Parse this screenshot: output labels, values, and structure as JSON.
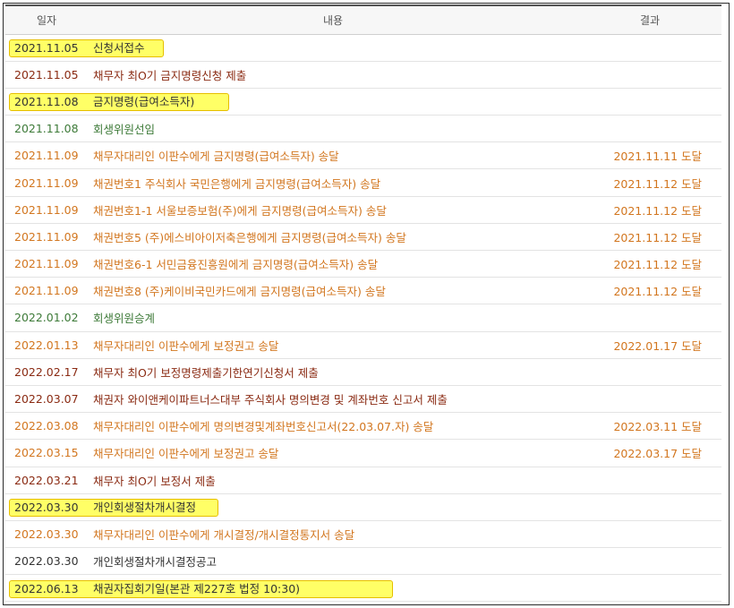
{
  "headers": {
    "date": "일자",
    "content": "내용",
    "result": "결과"
  },
  "rows": [
    {
      "date": "2021.11.05",
      "content": "신청서접수",
      "result": "",
      "color": "#333333",
      "highlight": true
    },
    {
      "date": "2021.11.05",
      "content": "채무자 최O기 금지명령신청 제출",
      "result": "",
      "color": "#8a2a12",
      "highlight": false
    },
    {
      "date": "2021.11.08",
      "content": "금지명령(급여소득자)",
      "result": "",
      "color": "#333333",
      "highlight": true
    },
    {
      "date": "2021.11.08",
      "content": "회생위원선임",
      "result": "",
      "color": "#3d7a38",
      "highlight": false
    },
    {
      "date": "2021.11.09",
      "content": "채무자대리인 이판수에게 금지명령(급여소득자) 송달",
      "result": "2021.11.11 도달",
      "color": "#d2761f",
      "highlight": false
    },
    {
      "date": "2021.11.09",
      "content": "채권번호1 주식회사 국민은행에게 금지명령(급여소득자) 송달",
      "result": "2021.11.12 도달",
      "color": "#d2761f",
      "highlight": false
    },
    {
      "date": "2021.11.09",
      "content": "채권번호1-1 서울보증보험(주)에게 금지명령(급여소득자) 송달",
      "result": "2021.11.12 도달",
      "color": "#d2761f",
      "highlight": false
    },
    {
      "date": "2021.11.09",
      "content": "채권번호5 (주)에스비아이저축은행에게 금지명령(급여소득자) 송달",
      "result": "2021.11.12 도달",
      "color": "#d2761f",
      "highlight": false
    },
    {
      "date": "2021.11.09",
      "content": "채권번호6-1 서민금융진흥원에게 금지명령(급여소득자) 송달",
      "result": "2021.11.12 도달",
      "color": "#d2761f",
      "highlight": false
    },
    {
      "date": "2021.11.09",
      "content": "채권번호8 (주)케이비국민카드에게 금지명령(급여소득자) 송달",
      "result": "2021.11.12 도달",
      "color": "#d2761f",
      "highlight": false
    },
    {
      "date": "2022.01.02",
      "content": "회생위원승계",
      "result": "",
      "color": "#3d7a38",
      "highlight": false
    },
    {
      "date": "2022.01.13",
      "content": "채무자대리인 이판수에게 보정권고 송달",
      "result": "2022.01.17 도달",
      "color": "#d2761f",
      "highlight": false
    },
    {
      "date": "2022.02.17",
      "content": "채무자 최O기 보정명령제출기한연기신청서 제출",
      "result": "",
      "color": "#8a2a12",
      "highlight": false
    },
    {
      "date": "2022.03.07",
      "content": "채권자 와이앤케이파트너스대부 주식회사 명의변경 및 계좌번호 신고서 제출",
      "result": "",
      "color": "#8a2a12",
      "highlight": false
    },
    {
      "date": "2022.03.08",
      "content": "채무자대리인 이판수에게 명의변경및계좌번호신고서(22.03.07.자) 송달",
      "result": "2022.03.11 도달",
      "color": "#d2761f",
      "highlight": false
    },
    {
      "date": "2022.03.15",
      "content": "채무자대리인 이판수에게 보정권고 송달",
      "result": "2022.03.17 도달",
      "color": "#d2761f",
      "highlight": false
    },
    {
      "date": "2022.03.21",
      "content": "채무자 최O기 보정서 제출",
      "result": "",
      "color": "#8a2a12",
      "highlight": false
    },
    {
      "date": "2022.03.30",
      "content": "개인회생절차개시결정",
      "result": "",
      "color": "#333333",
      "highlight": true
    },
    {
      "date": "2022.03.30",
      "content": "채무자대리인 이판수에게 개시결정/개시결정통지서 송달",
      "result": "",
      "color": "#d2761f",
      "highlight": false
    },
    {
      "date": "2022.03.30",
      "content": "개인회생절차개시결정공고",
      "result": "",
      "color": "#333333",
      "highlight": false
    },
    {
      "date": "2022.06.13",
      "content": "채권자집회기일(본관 제227호 법정 10:30)",
      "result": "",
      "color": "#333333",
      "highlight": true
    }
  ]
}
